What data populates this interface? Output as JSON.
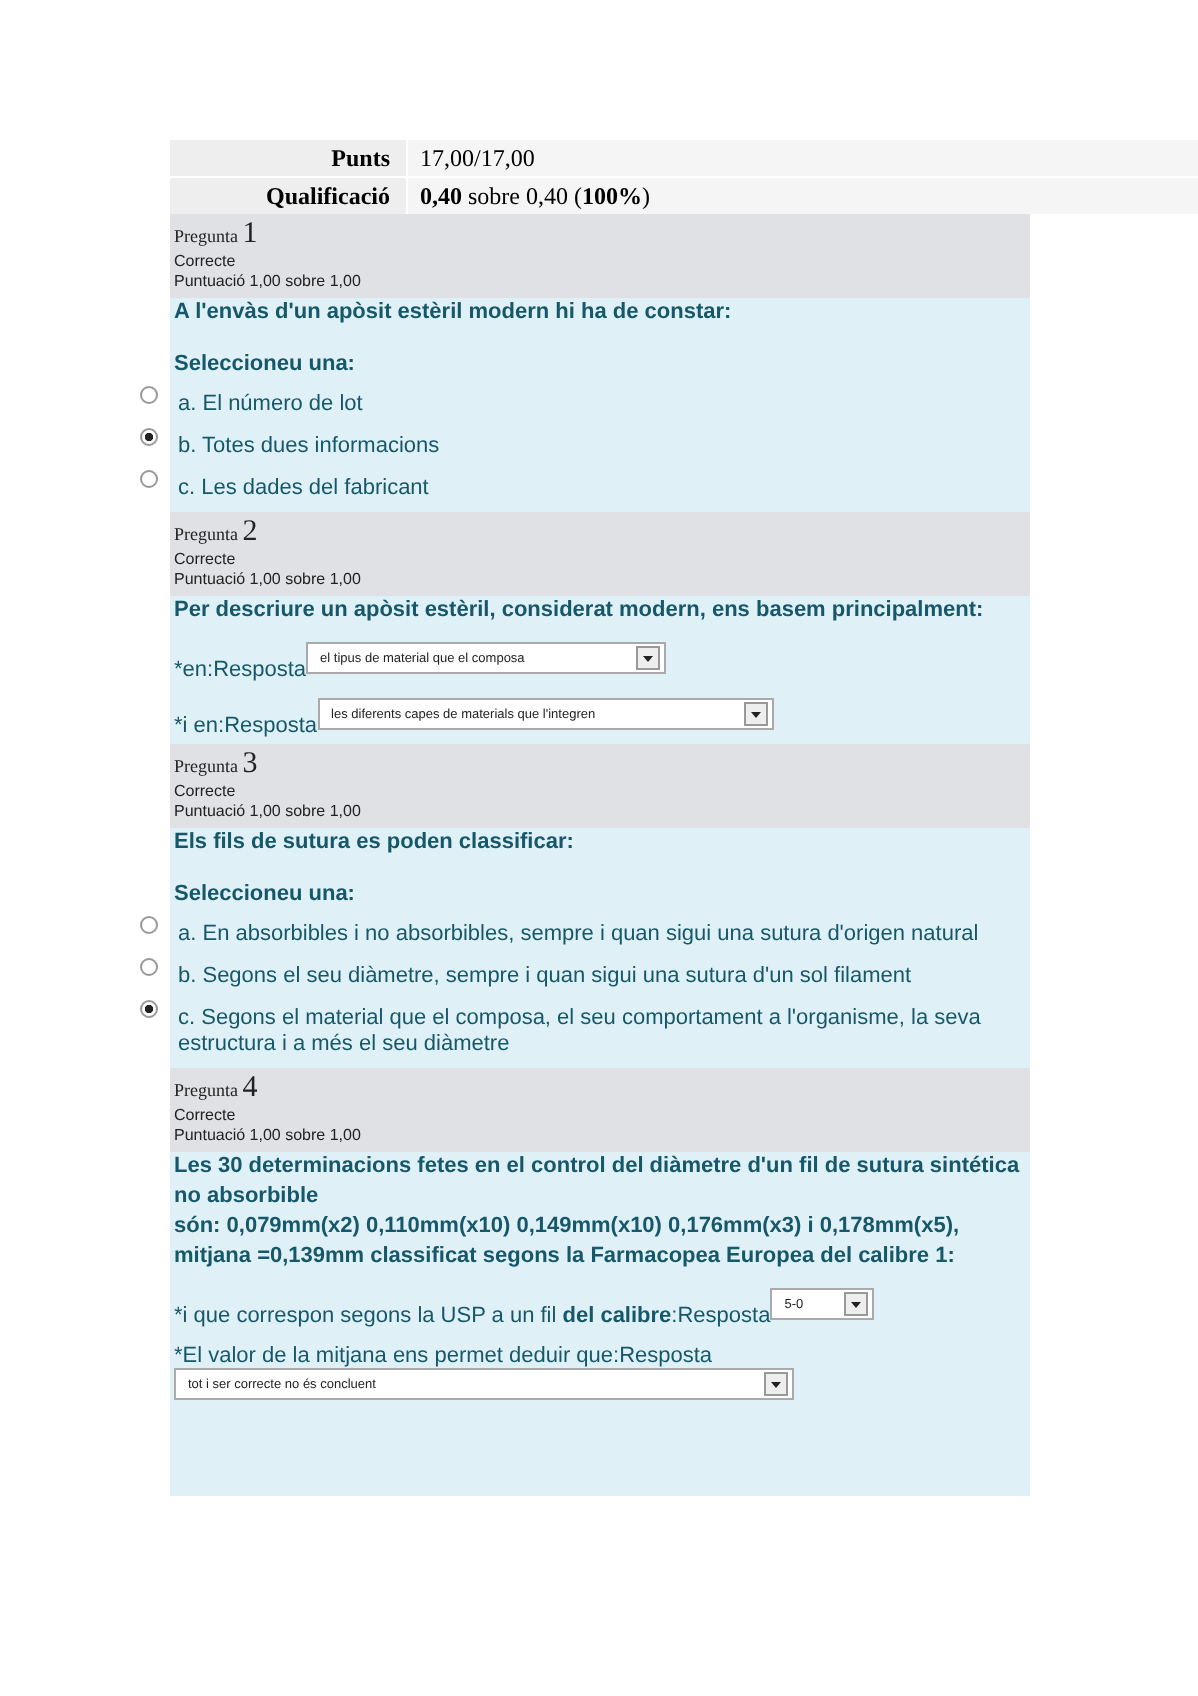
{
  "summary": [
    {
      "label": "Punts",
      "value": "17,00/17,00"
    },
    {
      "label": "Qualificació",
      "value": "**0,40** sobre 0,40 (**100%**)"
    }
  ],
  "questions": [
    {
      "kind": "multichoice",
      "label": "Pregunta",
      "number": "1",
      "state": "Correcte",
      "score": "Puntuació 1,00 sobre 1,00",
      "text": [
        "A l'envàs d'un apòsit estèril modern hi ha de constar:"
      ],
      "prompt": "Seleccioneu una:",
      "options": [
        {
          "label": "a. El número de lot",
          "selected": false
        },
        {
          "label": "b. Totes dues informacions",
          "selected": true
        },
        {
          "label": "c. Les dades del fabricant",
          "selected": false
        }
      ]
    },
    {
      "kind": "dropdowns",
      "label": "Pregunta",
      "number": "2",
      "state": "Correcte",
      "score": "Puntuació 1,00 sobre 1,00",
      "text": [
        "Per descriure un apòsit estèril, considerat modern, ens basem principalment:"
      ],
      "fields": [
        {
          "kind": "inline",
          "label": "*en:Resposta",
          "value": "el tipus de material que el composa"
        },
        {
          "kind": "inline",
          "label": "*i en:Resposta",
          "value": "les diferents capes de materials que l'integren"
        }
      ]
    },
    {
      "kind": "multichoice",
      "label": "Pregunta",
      "number": "3",
      "state": "Correcte",
      "score": "Puntuació 1,00 sobre 1,00",
      "text": [
        "Els fils de sutura es poden classificar:"
      ],
      "prompt": "Seleccioneu una:",
      "options": [
        {
          "label": "a. En absorbibles i no absorbibles, sempre i quan sigui una sutura d'origen natural",
          "selected": false
        },
        {
          "label": "b. Segons el seu diàmetre, sempre i quan sigui una sutura d'un sol filament",
          "selected": false
        },
        {
          "label": "c. Segons el material que el composa, el seu comportament a l'organisme, la seva estructura i a més el seu diàmetre",
          "selected": true
        }
      ]
    },
    {
      "kind": "dropdowns",
      "label": "Pregunta",
      "number": "4",
      "state": "Correcte",
      "score": "Puntuació 1,00 sobre 1,00",
      "text": [
        "Les 30 determinacions fetes en el control del diàmetre d'un fil de sutura sintética no absorbible",
        "són: 0,079mm(x2) 0,110mm(x10) 0,149mm(x10) 0,176mm(x3) i 0,178mm(x5), mitjana =0,139mm classificat segons la Farmacopea Europea del calibre 1:"
      ],
      "fields": [
        {
          "kind": "inline",
          "label": "*i que correspon segons la USP a un fil **del calibre**:Resposta",
          "value": "5-0"
        },
        {
          "kind": "below",
          "label": "*El valor de la mitjana ens permet deduir que:Resposta",
          "value": "tot i ser correcte no és concluent"
        }
      ]
    }
  ]
}
